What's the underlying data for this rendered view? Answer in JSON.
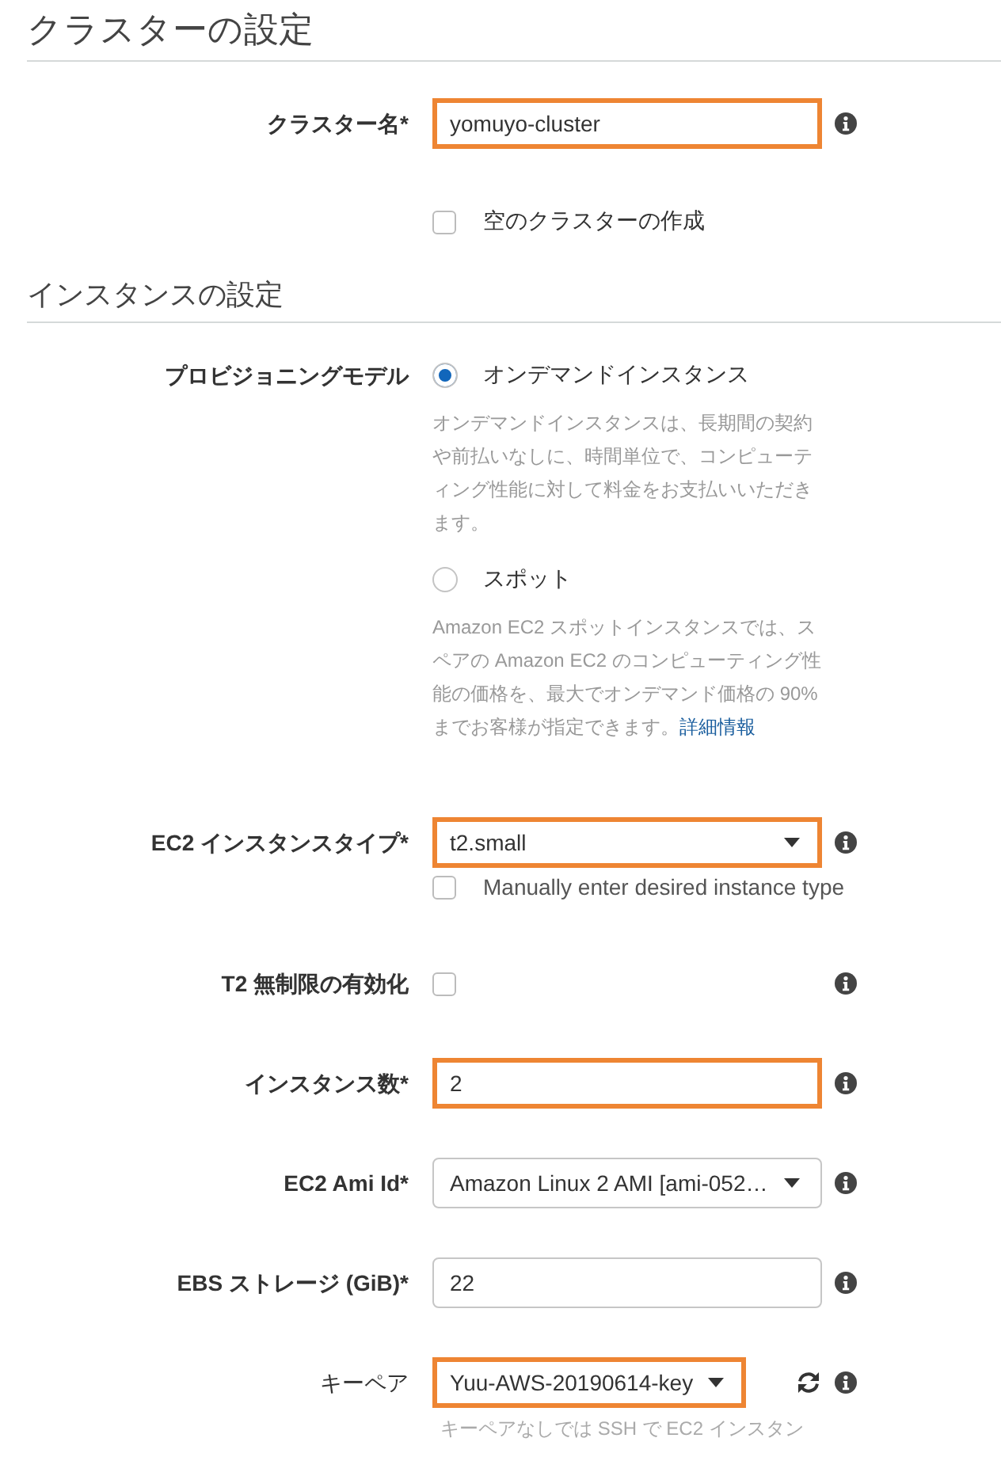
{
  "heading": "クラスターの設定",
  "fields": [
    {
      "kind": "text",
      "label": "クラスター名*",
      "value": "yomuyo-cluster",
      "highlighted": true,
      "info": true
    },
    {
      "kind": "checkbox",
      "label": "空のクラスターの作成",
      "checked": false
    }
  ],
  "sections": [
    {
      "title": "インスタンスの設定",
      "fields": [
        {
          "kind": "radios",
          "label": "プロビジョニングモデル",
          "options": [
            {
              "label": "オンデマンドインスタンス",
              "selected": true,
              "description": "オンデマンドインスタンスは、長期間の契約や前払いなしに、時間単位で、コンピューティング性能に対して料金をお支払いいただきます。"
            },
            {
              "label": "スポット",
              "selected": false,
              "description": "Amazon EC2 スポットインスタンスでは、スペアの Amazon EC2 のコンピューティング性能の価格を、最大でオンデマンド価格の 90% までお客様が指定できます。",
              "link": "詳細情報"
            }
          ]
        },
        {
          "kind": "select",
          "label": "EC2 インスタンスタイプ*",
          "value": "t2.small",
          "highlighted": true,
          "info": true,
          "checkbox": {
            "label": "Manually enter desired instance type",
            "checked": false
          }
        },
        {
          "kind": "toggle",
          "label": "T2 無制限の有効化",
          "checked": false,
          "info": true
        },
        {
          "kind": "text",
          "label": "インスタンス数*",
          "value": "2",
          "highlighted": true,
          "info": true
        },
        {
          "kind": "select",
          "label": "EC2 Ami Id*",
          "value": "Amazon Linux 2 AMI [ami-052…",
          "highlighted": false,
          "info": true
        },
        {
          "kind": "text",
          "label": "EBS ストレージ (GiB)*",
          "value": "22",
          "highlighted": false,
          "info": true
        },
        {
          "kind": "keypair",
          "label": "キーペア",
          "value": "Yuu-AWS-20190614-key",
          "highlighted": true,
          "info": true,
          "hint": "キーペアなしでは SSH で EC2 インスタン"
        }
      ]
    }
  ]
}
